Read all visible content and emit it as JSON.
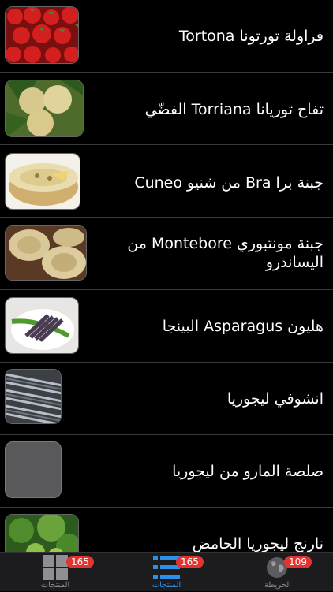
{
  "items": [
    {
      "title": "فراولة تورتونا Tortona"
    },
    {
      "title": "تفاح توريانا Torriana الفضّي"
    },
    {
      "title": "جبنة برا Bra من شنيو Cuneo"
    },
    {
      "title": "جبنة مونتبوري Montebore من اليساندرو"
    },
    {
      "title": "هليون Asparagus البينجا"
    },
    {
      "title": "انشوفي ليجوريا"
    },
    {
      "title": "صلصة المارو من ليجوريا"
    },
    {
      "title": "نارنج ليجوريا الحامض"
    }
  ],
  "tabs": [
    {
      "label": "المنتجات",
      "badge": "165",
      "icon": "grid-icon"
    },
    {
      "label": "المنتجات",
      "badge": "165",
      "icon": "list-icon"
    },
    {
      "label": "الخريطة",
      "badge": "109",
      "icon": "globe-icon"
    }
  ],
  "colors": {
    "accent": "#2e8fe8",
    "badge": "#e4332f",
    "background": "#000000"
  }
}
